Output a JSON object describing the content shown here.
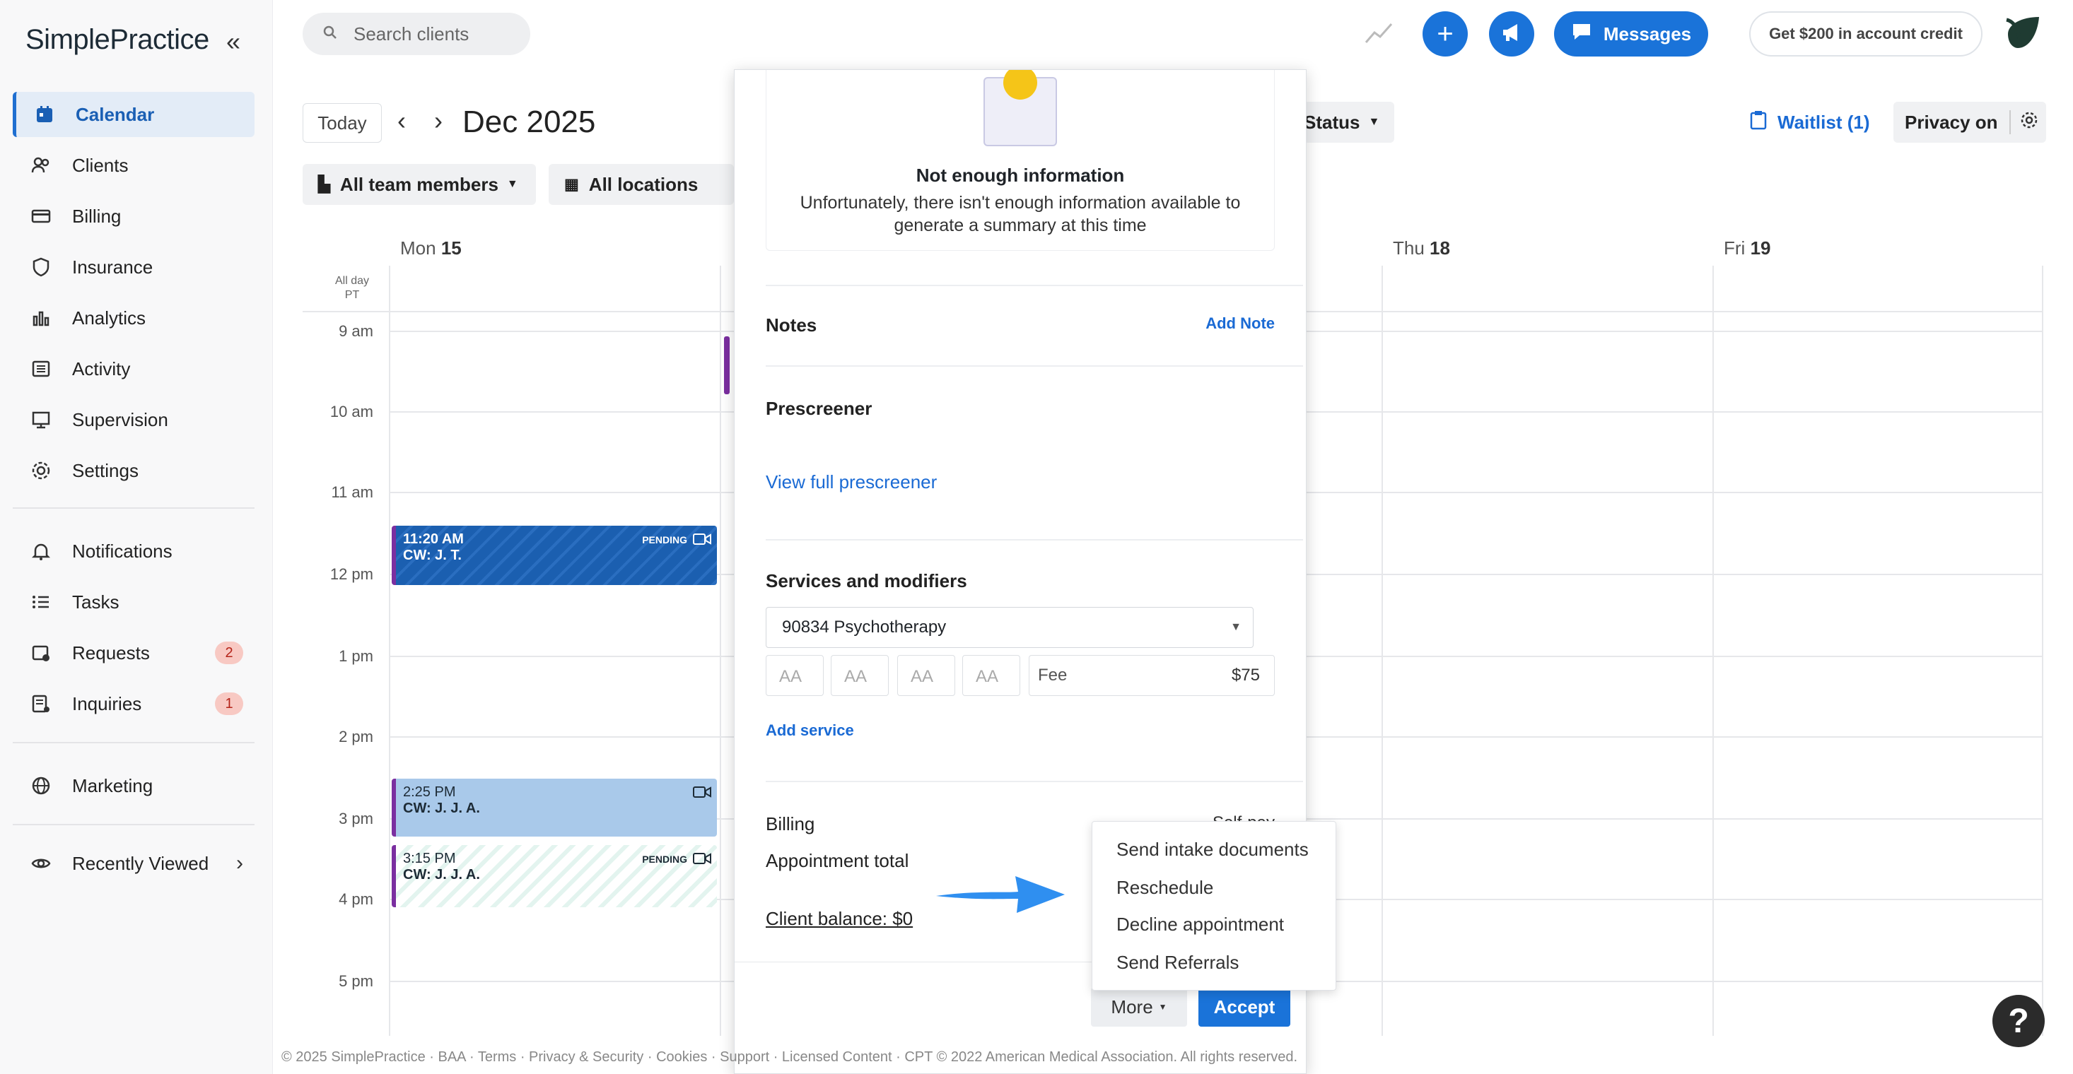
{
  "app": {
    "logo": "SimplePractice"
  },
  "sidebar": {
    "items": [
      {
        "label": "Calendar",
        "icon": "calendar-icon"
      },
      {
        "label": "Clients",
        "icon": "clients-icon"
      },
      {
        "label": "Billing",
        "icon": "billing-icon"
      },
      {
        "label": "Insurance",
        "icon": "shield-icon"
      },
      {
        "label": "Analytics",
        "icon": "bar-chart-icon"
      },
      {
        "label": "Activity",
        "icon": "activity-icon"
      },
      {
        "label": "Supervision",
        "icon": "supervision-icon"
      },
      {
        "label": "Settings",
        "icon": "gear-icon"
      },
      {
        "label": "Notifications",
        "icon": "bell-icon"
      },
      {
        "label": "Tasks",
        "icon": "tasks-icon"
      },
      {
        "label": "Requests",
        "icon": "requests-icon",
        "badge": "2"
      },
      {
        "label": "Inquiries",
        "icon": "inquiries-icon",
        "badge": "1"
      },
      {
        "label": "Marketing",
        "icon": "globe-icon"
      },
      {
        "label": "Recently Viewed",
        "icon": "eye-icon"
      }
    ]
  },
  "topbar": {
    "search_placeholder": "Search clients",
    "messages_label": "Messages",
    "credit_label": "Get $200 in account credit"
  },
  "toolbar": {
    "today_label": "Today",
    "month_label": "Dec 2025",
    "team_filter": "All team members",
    "location_filter": "All locations",
    "status_filter": "Status",
    "waitlist_label": "Waitlist (1)",
    "privacy_label": "Privacy on"
  },
  "calendar": {
    "allday_label": "All day",
    "timezone": "PT",
    "days": [
      {
        "name": "Mon",
        "num": "15"
      },
      {
        "name": "Thu",
        "num": "18"
      },
      {
        "name": "Fri",
        "num": "19"
      }
    ],
    "hours": [
      "9 am",
      "10 am",
      "11 am",
      "12 pm",
      "1 pm",
      "2 pm",
      "3 pm",
      "4 pm",
      "5 pm"
    ],
    "appointments": [
      {
        "time": "11:20 AM",
        "client": "CW: J. T.",
        "status": "PENDING"
      },
      {
        "time": "2:25 PM",
        "client": "CW: J. J. A.",
        "status": ""
      },
      {
        "time": "3:15 PM",
        "client": "CW: J. J. A.",
        "status": "PENDING"
      }
    ]
  },
  "panel": {
    "summary_title": "Not enough information",
    "summary_text": "Unfortunately, there isn't enough information available to generate a summary at this time",
    "notes_title": "Notes",
    "add_note": "Add Note",
    "prescreener_title": "Prescreener",
    "view_prescreener": "View full prescreener",
    "services_title": "Services and modifiers",
    "service_selected": "90834 Psychotherapy",
    "modifier_placeholder": "AA",
    "fee_label": "Fee",
    "fee_value": "$75",
    "add_service": "Add service",
    "billing_title": "Billing",
    "billing_type": "Self-pay",
    "appointment_total": "Appointment total",
    "client_balance": "Client balance: $0",
    "more_label": "More",
    "accept_label": "Accept"
  },
  "more_menu": {
    "items": [
      "Send intake documents",
      "Reschedule",
      "Decline appointment",
      "Send Referrals"
    ]
  },
  "footer": {
    "text": "© 2025 SimplePractice · BAA · Terms · Privacy & Security · Cookies · Support · Licensed Content · CPT © 2022 American Medical Association. All rights reserved."
  },
  "colors": {
    "accent": "#1a73d9",
    "appointment_blue": "#1b5fb0",
    "appointment_light": "#a9c9ea",
    "pending_purple": "#7b2fa0"
  }
}
